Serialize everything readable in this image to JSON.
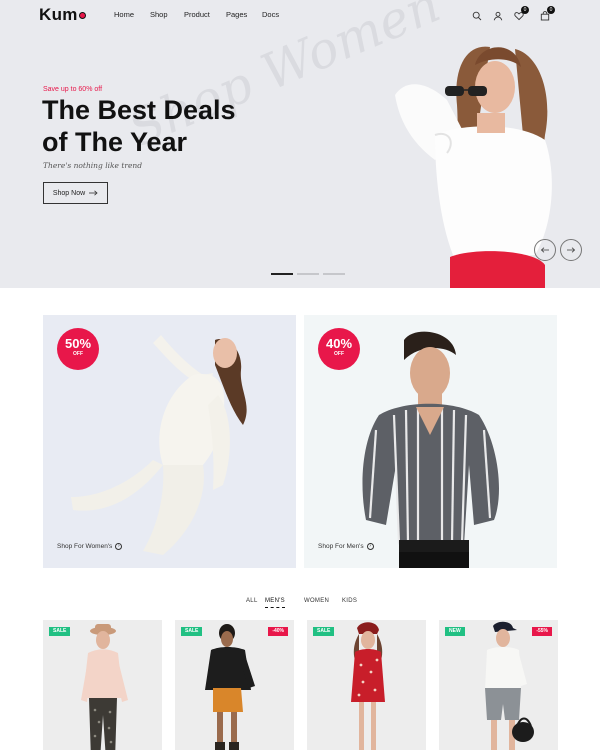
{
  "brand": {
    "name": "Kumo",
    "accent": "#e8174a"
  },
  "nav": {
    "items": [
      "Home",
      "Shop",
      "Product",
      "Pages",
      "Docs"
    ]
  },
  "header_icons": {
    "search": "search-icon",
    "account": "user-icon",
    "wishlist_count": "0",
    "cart_count": "0"
  },
  "hero": {
    "promo_sub": "Save up to 60% off",
    "title_line1": "The Best Deals",
    "title_line2": "of The Year",
    "tagline": "There's nothing like trend",
    "button_label": "Shop Now",
    "watermark": "Shop Women"
  },
  "promos": [
    {
      "discount": "50%",
      "off": "OFF",
      "link": "Shop For Women's"
    },
    {
      "discount": "40%",
      "off": "OFF",
      "link": "Shop For Men's"
    }
  ],
  "tabs": [
    "ALL",
    "MEN'S",
    "WOMEN",
    "KIDS"
  ],
  "active_tab": "MEN'S",
  "products": [
    {
      "tag": "SALE",
      "discount": ""
    },
    {
      "tag": "SALE",
      "discount": "-40%"
    },
    {
      "tag": "SALE",
      "discount": ""
    },
    {
      "tag": "NEW",
      "discount": "-55%"
    }
  ]
}
